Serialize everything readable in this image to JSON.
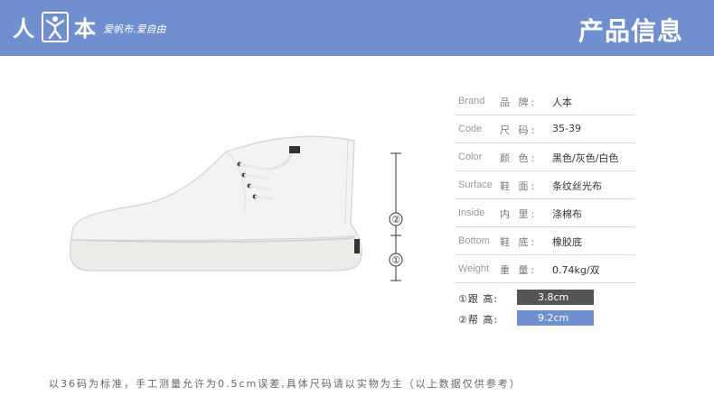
{
  "header": {
    "logo_left": "人",
    "logo_right": "本",
    "slogan": "爱帆布.爱自由",
    "title": "产品信息",
    "bg_color": "#6f8fcf"
  },
  "specs": [
    {
      "en": "Brand",
      "cn": "品 牌:",
      "value": "人本"
    },
    {
      "en": "Code",
      "cn": "尺 码:",
      "value": "35-39"
    },
    {
      "en": "Color",
      "cn": "颜 色:",
      "value": "黑色/灰色/白色"
    },
    {
      "en": "Surface",
      "cn": "鞋 面:",
      "value": "条纹丝光布"
    },
    {
      "en": "Inside",
      "cn": "内 里:",
      "value": "涤棉布"
    },
    {
      "en": "Bottom",
      "cn": "鞋 底:",
      "value": "橡胶底"
    },
    {
      "en": "Weight",
      "cn": "重 量:",
      "value": "0.74kg/双"
    }
  ],
  "heights": [
    {
      "label": "①跟 高:",
      "value": "3.8cm",
      "color": "#555555"
    },
    {
      "label": "②帮 高:",
      "value": "9.2cm",
      "color": "#6f8fcf"
    }
  ],
  "measure_markers": [
    "①",
    "②"
  ],
  "footnote": "以36码为标准，手工测量允许为0.5cm误差,具体尺码请以实物为主（以上数据仅供参考）"
}
